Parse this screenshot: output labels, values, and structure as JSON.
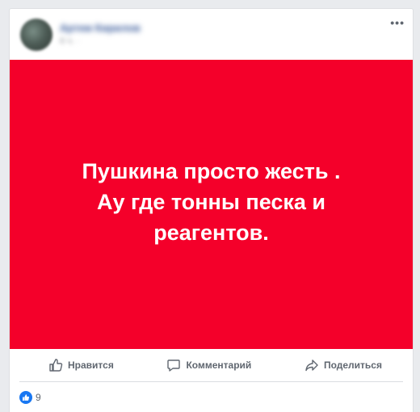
{
  "post": {
    "author": "Артем Кирилов",
    "meta": "6 ч. ·",
    "menu_label": "•••",
    "text": "Пушкина просто жесть . Ау где тонны песка и реагентов.",
    "image_background": "#f4002a"
  },
  "actions": {
    "like": "Нравится",
    "comment": "Комментарий",
    "share": "Поделиться"
  },
  "reactions": {
    "count": "9",
    "icon": "like-icon",
    "accent": "#1877f2"
  }
}
